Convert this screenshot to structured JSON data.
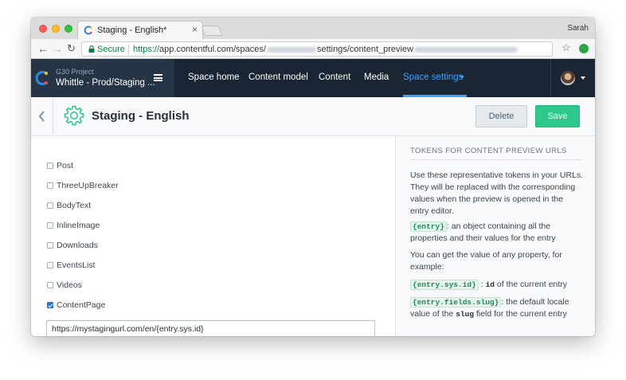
{
  "browser": {
    "tab_title": "Staging - English*",
    "tab_close": "×",
    "user": "Sarah",
    "secure_label": "Secure",
    "url_scheme": "https://",
    "url_host": "app.contentful.com",
    "url_path_a": "/spaces/",
    "url_path_b": "settings/content_preview",
    "back_glyph": "←",
    "forward_glyph": "→",
    "reload_glyph": "↻",
    "star_glyph": "☆"
  },
  "appnav": {
    "project": "G30 Project",
    "space": "Whittle - Prod/Staging ...",
    "links": [
      "Space home",
      "Content model",
      "Content",
      "Media",
      "Space settings"
    ]
  },
  "header": {
    "title": "Staging - English",
    "delete_label": "Delete",
    "save_label": "Save"
  },
  "content_types": [
    {
      "label": "Post",
      "checked": false
    },
    {
      "label": "ThreeUpBreaker",
      "checked": false
    },
    {
      "label": "BodyText",
      "checked": false
    },
    {
      "label": "InlineImage",
      "checked": false
    },
    {
      "label": "Downloads",
      "checked": false
    },
    {
      "label": "EventsList",
      "checked": false
    },
    {
      "label": "Videos",
      "checked": false
    },
    {
      "label": "ContentPage",
      "checked": true
    }
  ],
  "preview_url": "https://mystagingurl.com/en/{entry.sys.id}",
  "sidebar": {
    "heading": "TOKENS FOR CONTENT PREVIEW URLS",
    "intro": "Use these representative tokens in your URLs. They will be replaced with the corresponding values when the preview is opened in the entry editor.",
    "token_entry": "{entry}",
    "token_entry_desc": ": an object containing all the properties and their values for the entry",
    "property_intro": "You can get the value of any property, for example:",
    "token_sys_id": "{entry.sys.id}",
    "token_sys_id_sep": ":",
    "token_sys_id_code": "id",
    "token_sys_id_desc": "of the current entry",
    "token_slug": "{entry.fields.slug}",
    "token_slug_desc_a": ": the default locale value of the",
    "token_slug_code": "slug",
    "token_slug_desc_b": "field for the current entry"
  },
  "colors": {
    "nav_bg": "#192532",
    "accent_blue": "#3ea1ff",
    "save_green": "#2fc88c",
    "checkbox_blue": "#2e75d4"
  },
  "icons": {
    "logo": "contentful-logo-icon",
    "settings": "gear-icon",
    "back": "chevron-left-icon"
  }
}
